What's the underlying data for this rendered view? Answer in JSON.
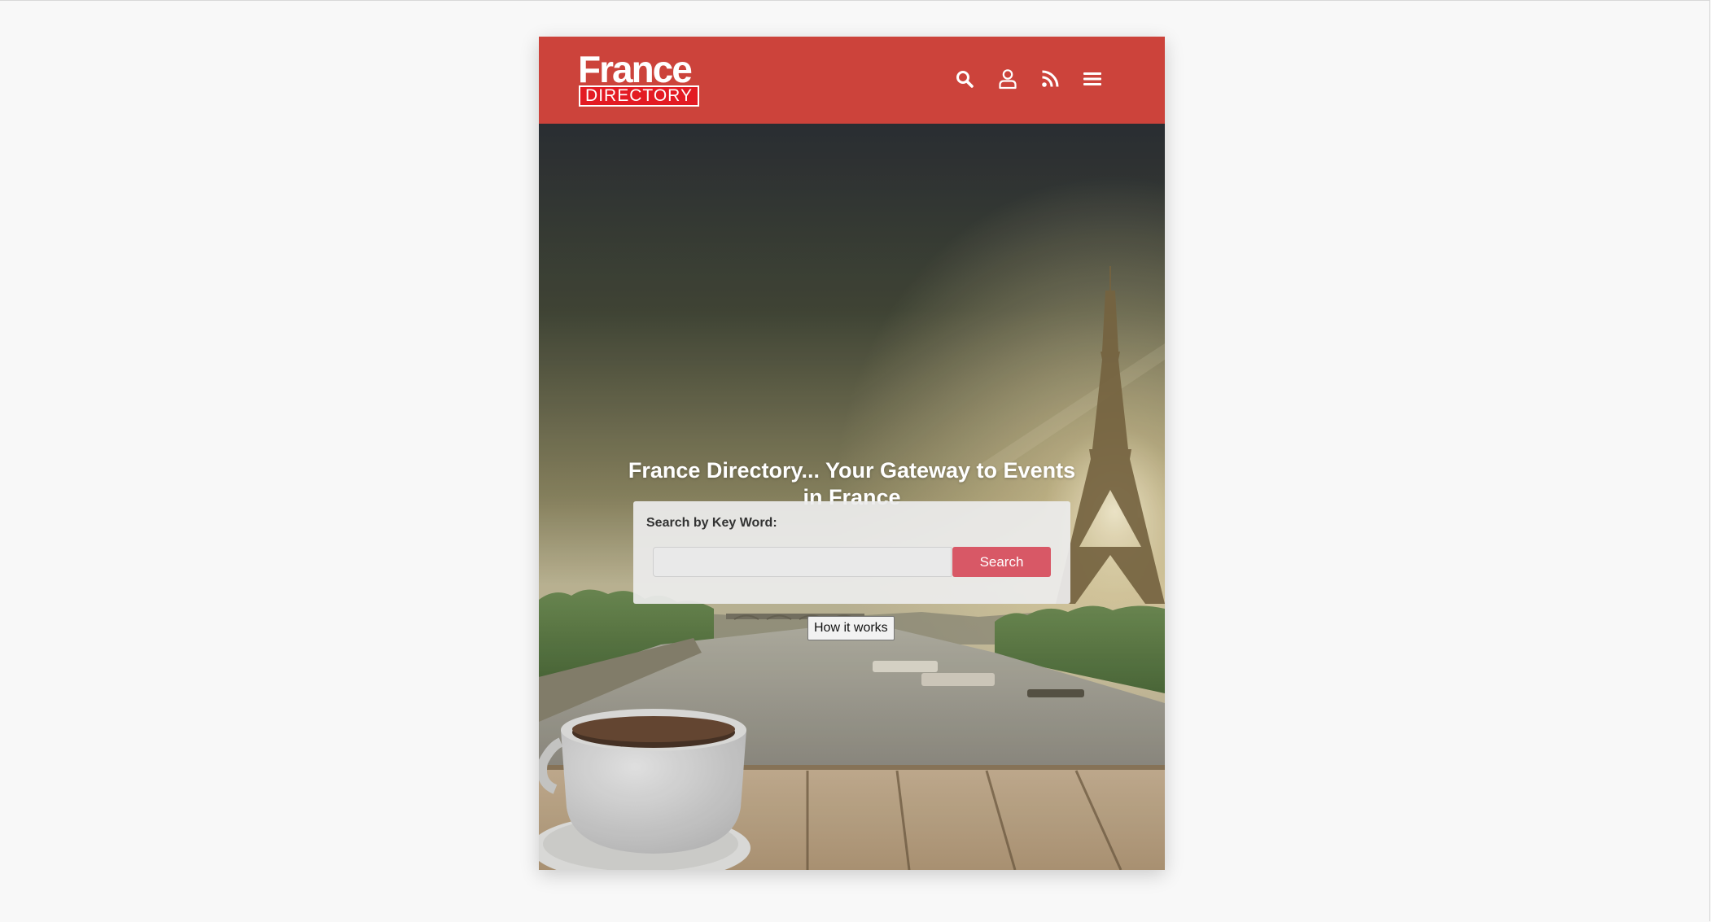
{
  "brand": {
    "logo_top": "France",
    "logo_bottom": "DIRECTORY",
    "header_color": "#cc433b",
    "logo_badge_color": "#e31b23"
  },
  "nav": {
    "icons": [
      "search-icon",
      "user-icon",
      "rss-icon",
      "menu-icon"
    ]
  },
  "hero": {
    "title": "France Directory... Your Gateway to Events in France",
    "scene": "Eiffel Tower and Seine at sunset, coffee cup on wooden deck"
  },
  "search": {
    "label": "Search by Key Word:",
    "input_value": "",
    "placeholder": "",
    "button_label": "Search",
    "button_color": "#d85866"
  },
  "how_it_works": {
    "label": "How it works"
  }
}
